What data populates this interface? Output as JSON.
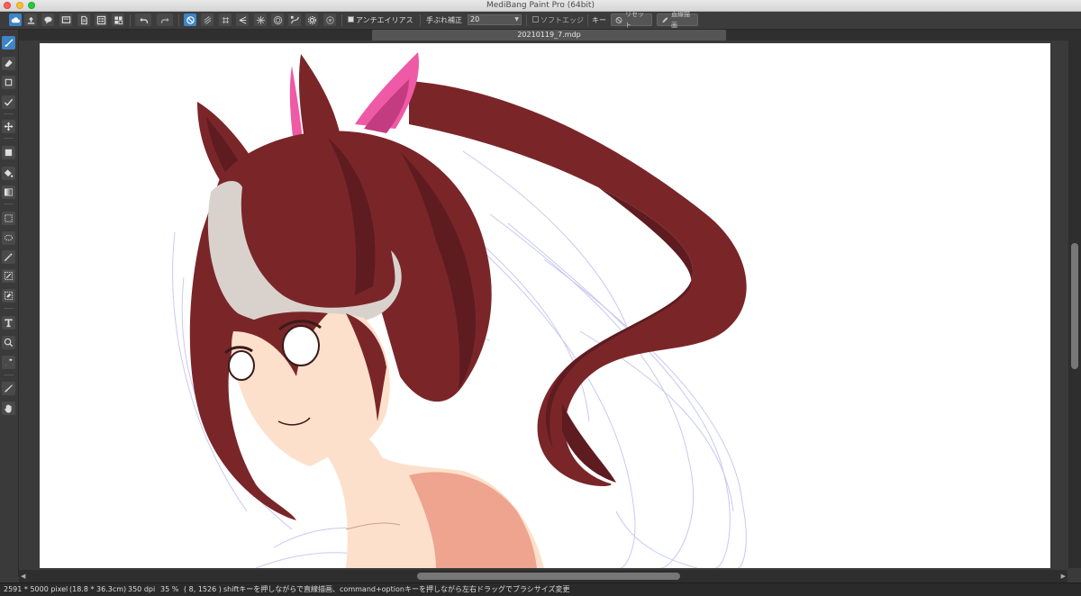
{
  "window": {
    "title": "MediBang Paint Pro (64bit)"
  },
  "toolbar": {
    "buttons": [
      {
        "name": "cloud-icon",
        "label": ""
      },
      {
        "name": "upload-icon",
        "label": ""
      },
      {
        "name": "speech-bubble-icon",
        "label": ""
      },
      {
        "name": "panel-icon",
        "label": ""
      },
      {
        "name": "document-icon",
        "label": ""
      },
      {
        "name": "page-list-icon",
        "label": ""
      },
      {
        "name": "grid-layout-icon",
        "label": ""
      }
    ],
    "antialias_label": "アンチエイリアス",
    "antialias_checked": true,
    "stabilizer_label": "手ぶれ補正",
    "stabilizer_value": "20",
    "soft_edge_label": "ソフトエッジ",
    "soft_edge_checked": false,
    "key_label": "キー",
    "reset_label": "リセット",
    "straight_line_label": "直線描画"
  },
  "document": {
    "tab_title": "20210119_7.mdp"
  },
  "status": {
    "size": "2591 * 5000 pixel",
    "physical_size": "(18.8 * 36.3cm)",
    "dpi": "350 dpi",
    "zoom": "35 %",
    "cursor": "( 8, 1526 )",
    "hint": "shiftキーを押しながらで直線描画、command+optionキーを押しながら左右ドラッグでブラシサイズ変更"
  },
  "colors": {
    "accent": "#3d85c6",
    "hair": "#7a2629",
    "hair_shadow": "#5e1c20",
    "skin": "#fde0cc",
    "skin_shadow": "#eea48e",
    "ribbon": "#ee5aa6",
    "sketch": "#c8c8f0",
    "white_streak": "#d9d2cc"
  }
}
